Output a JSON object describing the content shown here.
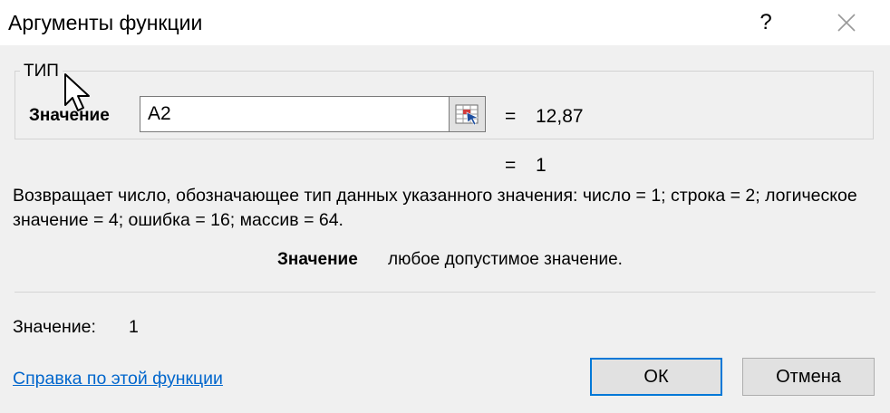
{
  "window": {
    "title": "Аргументы функции",
    "help_glyph": "?",
    "close_icon": "close-icon"
  },
  "function_group": {
    "name": "ТИП",
    "argument": {
      "label": "Значение",
      "input_value": "A2",
      "equals": "=",
      "evaluated": "12,87"
    },
    "formula_result": {
      "equals": "=",
      "value": "1"
    }
  },
  "description": "Возвращает число, обозначающее тип данных указанного значения: число = 1; строка = 2; логическое значение = 4; ошибка = 16; массив = 64.",
  "argument_help": {
    "name": "Значение",
    "text": "любое допустимое значение."
  },
  "result": {
    "label": "Значение:",
    "value": "1"
  },
  "footer": {
    "help_link": "Справка по этой функции",
    "ok_label": "ОК",
    "cancel_label": "Отмена"
  },
  "colors": {
    "link": "#0066cc",
    "default_button_border": "#0078d7",
    "background": "#f0f0f0"
  }
}
